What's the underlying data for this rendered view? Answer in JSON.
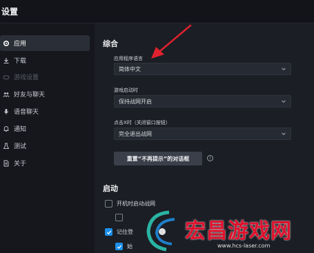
{
  "window": {
    "title": "设置"
  },
  "sidebar": {
    "items": [
      {
        "label": "应用",
        "icon": "gear-icon",
        "active": true,
        "disabled": false
      },
      {
        "label": "下载",
        "icon": "download-icon",
        "active": false,
        "disabled": false
      },
      {
        "label": "游戏设置",
        "icon": "gamepad-icon",
        "active": false,
        "disabled": true
      },
      {
        "label": "好友与聊天",
        "icon": "people-icon",
        "active": false,
        "disabled": false
      },
      {
        "label": "语音聊天",
        "icon": "mic-icon",
        "active": false,
        "disabled": false
      },
      {
        "label": "通知",
        "icon": "bell-icon",
        "active": false,
        "disabled": false
      },
      {
        "label": "测试",
        "icon": "flask-icon",
        "active": false,
        "disabled": false
      },
      {
        "label": "关于",
        "icon": "document-icon",
        "active": false,
        "disabled": false
      }
    ]
  },
  "general": {
    "heading": "综合",
    "language": {
      "label": "应用程序语言",
      "value": "简体中文"
    },
    "game_launch": {
      "label": "游戏启动时",
      "value": "保持战网开启"
    },
    "close_x": {
      "label": "点击X时（关闭窗口按钮）",
      "value": "完全退出战网"
    },
    "reset_button": "重置“不再提示”的对话框"
  },
  "startup": {
    "heading": "启动",
    "options": [
      {
        "label": "开机时启动战网",
        "checked": false
      },
      {
        "label": "",
        "checked": false
      },
      {
        "label": "记住登",
        "checked": true
      },
      {
        "label": "始",
        "checked": true
      }
    ]
  },
  "watermark": {
    "text": "宏昌游戏网",
    "url": "www.hcs-laser.com"
  },
  "colors": {
    "accent": "#1d8fe8",
    "arrow": "#e0222e",
    "background": "#1b1e24"
  }
}
